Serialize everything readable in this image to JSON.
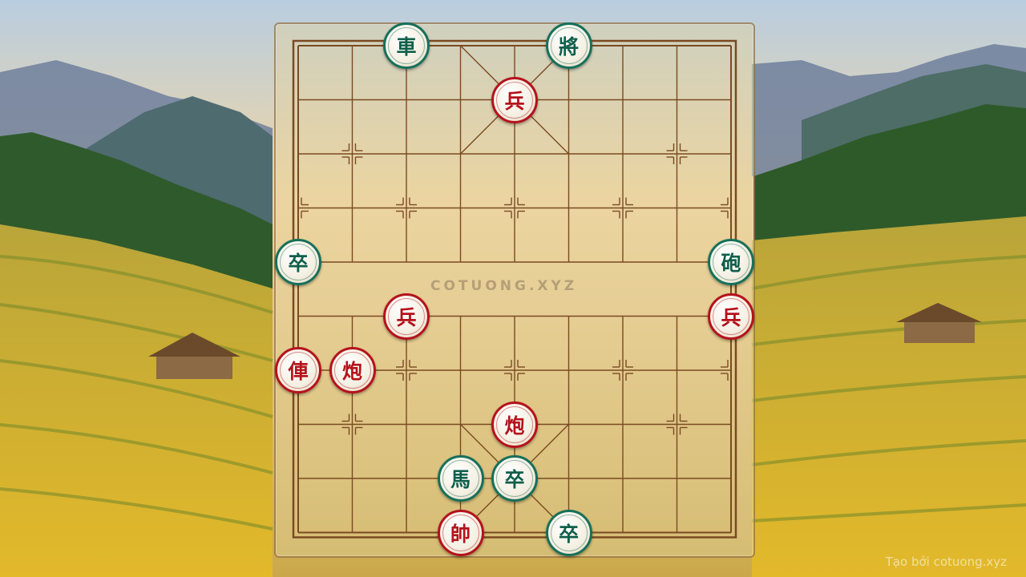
{
  "board": {
    "watermark": "COTUONG.XYZ",
    "credit": "Tạo bởi cotuong.xyz"
  },
  "pieces": [
    {
      "label": "車",
      "side": "black",
      "name": "black-chariot",
      "file": 2,
      "rank": 0
    },
    {
      "label": "將",
      "side": "black",
      "name": "black-general",
      "file": 5,
      "rank": 0
    },
    {
      "label": "兵",
      "side": "red",
      "name": "red-soldier",
      "file": 4,
      "rank": 1
    },
    {
      "label": "卒",
      "side": "black",
      "name": "black-soldier",
      "file": 0,
      "rank": 4
    },
    {
      "label": "砲",
      "side": "black",
      "name": "black-cannon",
      "file": 8,
      "rank": 4
    },
    {
      "label": "兵",
      "side": "red",
      "name": "red-soldier",
      "file": 2,
      "rank": 5
    },
    {
      "label": "兵",
      "side": "red",
      "name": "red-soldier",
      "file": 8,
      "rank": 5
    },
    {
      "label": "俥",
      "side": "red",
      "name": "red-chariot",
      "file": 0,
      "rank": 6
    },
    {
      "label": "炮",
      "side": "red",
      "name": "red-cannon",
      "file": 1,
      "rank": 6
    },
    {
      "label": "炮",
      "side": "red",
      "name": "red-cannon",
      "file": 4,
      "rank": 7
    },
    {
      "label": "馬",
      "side": "black",
      "name": "black-horse",
      "file": 3,
      "rank": 8
    },
    {
      "label": "卒",
      "side": "black",
      "name": "black-soldier",
      "file": 4,
      "rank": 8
    },
    {
      "label": "帥",
      "side": "red",
      "name": "red-general",
      "file": 3,
      "rank": 9
    },
    {
      "label": "卒",
      "side": "black",
      "name": "black-soldier",
      "file": 5,
      "rank": 9
    }
  ],
  "colors": {
    "red": "#b5121b",
    "black": "#16705a",
    "grid": "#7a4a22"
  }
}
